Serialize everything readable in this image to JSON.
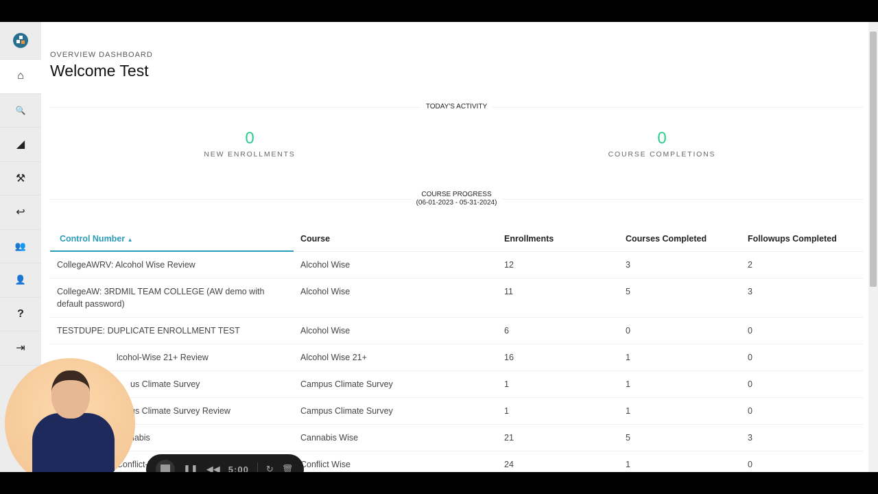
{
  "sidebar": {
    "items": [
      {
        "name": "logo",
        "icon": "logo-icon"
      },
      {
        "name": "home",
        "icon": "home-icon",
        "glyph": "⌂"
      },
      {
        "name": "search",
        "icon": "search-icon",
        "glyph": "🔍"
      },
      {
        "name": "analytics",
        "icon": "chart-area-icon",
        "glyph": "◢"
      },
      {
        "name": "tools",
        "icon": "tools-icon",
        "glyph": "⚒"
      },
      {
        "name": "redo",
        "icon": "return-icon",
        "glyph": "↩"
      },
      {
        "name": "users",
        "icon": "users-icon",
        "glyph": "👥"
      },
      {
        "name": "user",
        "icon": "user-icon",
        "glyph": "👤"
      },
      {
        "name": "help",
        "icon": "question-icon",
        "glyph": "?"
      },
      {
        "name": "logout",
        "icon": "sign-out-icon",
        "glyph": "⇥"
      }
    ]
  },
  "header": {
    "breadcrumb": "OVERVIEW DASHBOARD",
    "title": "Welcome Test"
  },
  "activity": {
    "label": "TODAY'S ACTIVITY",
    "new_enrollments": {
      "value": "0",
      "label": "NEW ENROLLMENTS"
    },
    "course_completions": {
      "value": "0",
      "label": "COURSE COMPLETIONS"
    }
  },
  "progress": {
    "label": "COURSE PROGRESS",
    "range": "(06-01-2023 - 05-31-2024)"
  },
  "table": {
    "columns": [
      "Control Number",
      "Course",
      "Enrollments",
      "Courses Completed",
      "Followups Completed"
    ],
    "sort_indicator": "▲",
    "rows": [
      [
        "CollegeAWRV: Alcohol Wise Review",
        "Alcohol Wise",
        "12",
        "3",
        "2"
      ],
      [
        "CollegeAW: 3RDMIL TEAM COLLEGE (AW demo with default password)",
        "Alcohol Wise",
        "11",
        "5",
        "3"
      ],
      [
        "TESTDUPE: DUPLICATE ENROLLMENT TEST",
        "Alcohol Wise",
        "6",
        "0",
        "0"
      ],
      [
        "lcohol-Wise 21+ Review",
        "Alcohol Wise 21+",
        "16",
        "1",
        "0"
      ],
      [
        "us Climate Survey",
        "Campus Climate Survey",
        "1",
        "1",
        "0"
      ],
      [
        "us Climate Survey Review",
        "Campus Climate Survey",
        "1",
        "1",
        "0"
      ],
      [
        "annabis",
        "Cannabis Wise",
        "21",
        "5",
        "3"
      ],
      [
        "CollegeCWRV: Conflict-Wise Review",
        "Conflict Wise",
        "24",
        "1",
        "0"
      ]
    ]
  },
  "recorder": {
    "time": "5:00"
  },
  "colors": {
    "accent": "#2a9bb8",
    "stat": "#2ecc8f",
    "sidebar": "#ececec"
  }
}
